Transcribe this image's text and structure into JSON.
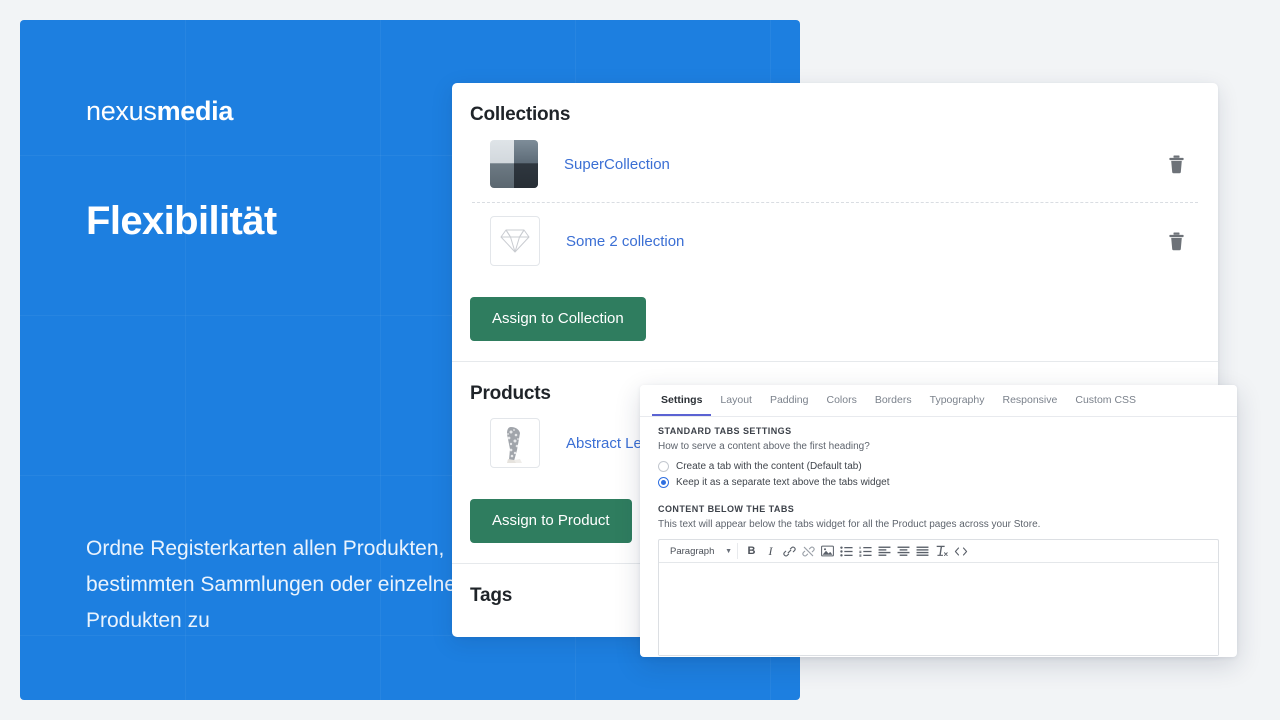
{
  "promo": {
    "logo_light": "nexus",
    "logo_bold": "media",
    "headline": "Flexibilität",
    "body": "Ordne Registerkarten allen Produkten, bestimmten Sammlungen oder einzelnen Produkten zu",
    "background_color": "#1d7fe0"
  },
  "main_card": {
    "collections": {
      "title": "Collections",
      "rows": [
        {
          "name": "SuperCollection",
          "thumb": "seascape-thumbnail",
          "delete_icon": "trash-icon"
        },
        {
          "name": "Some 2 collection",
          "thumb": "diamond-icon",
          "delete_icon": "trash-icon"
        }
      ],
      "assign_button": "Assign to Collection"
    },
    "products": {
      "title": "Products",
      "rows": [
        {
          "name": "Abstract Leggings",
          "thumb": "leggings-thumbnail"
        }
      ],
      "assign_button": "Assign to Product"
    },
    "tags": {
      "title": "Tags"
    },
    "button_color": "#2f7d5f",
    "link_color": "#3b6fd4"
  },
  "settings_panel": {
    "tabs": [
      {
        "label": "Settings",
        "active": true
      },
      {
        "label": "Layout",
        "active": false
      },
      {
        "label": "Padding",
        "active": false
      },
      {
        "label": "Colors",
        "active": false
      },
      {
        "label": "Borders",
        "active": false
      },
      {
        "label": "Typography",
        "active": false
      },
      {
        "label": "Responsive",
        "active": false
      },
      {
        "label": "Custom CSS",
        "active": false
      }
    ],
    "active_tab_color": "#5b63d3",
    "standard_tabs": {
      "label": "STANDARD TABS SETTINGS",
      "help": "How to serve a content above the first heading?",
      "options": [
        {
          "label": "Create a tab with the content (Default tab)",
          "selected": false
        },
        {
          "label": "Keep it as a separate text above the tabs widget",
          "selected": true
        }
      ]
    },
    "content_below": {
      "label": "CONTENT BELOW THE TABS",
      "help": "This text will appear below the tabs widget for all the Product pages across your Store.",
      "editor": {
        "format_select": "Paragraph",
        "tools": [
          "bold-icon",
          "italic-icon",
          "link-icon",
          "unlink-icon",
          "image-icon",
          "bullet-list-icon",
          "numbered-list-icon",
          "align-left-icon",
          "align-center-icon",
          "align-justify-icon",
          "clear-format-icon",
          "code-icon"
        ],
        "content": ""
      }
    }
  }
}
